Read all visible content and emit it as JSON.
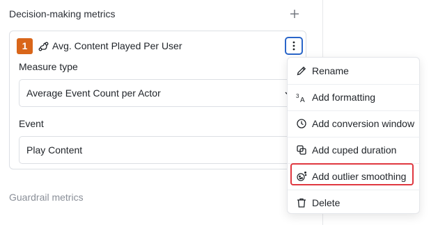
{
  "section": {
    "title": "Decision-making metrics",
    "add_icon": "plus-icon"
  },
  "metric": {
    "index": "1",
    "name": "Avg. Content Played Per User",
    "badge_color": "#d9661a"
  },
  "fields": {
    "measure_type_label": "Measure type",
    "measure_type_value": "Average Event Count per Actor",
    "event_label": "Event",
    "event_value": "Play Content"
  },
  "guardrail": {
    "title": "Guardrail metrics"
  },
  "menu": {
    "items": [
      {
        "label": "Rename",
        "icon": "pencil-icon"
      },
      {
        "label": "Add formatting",
        "icon": "formatting-icon"
      },
      {
        "label": "Add conversion window",
        "icon": "clock-icon"
      },
      {
        "label": "Add cuped duration",
        "icon": "cuped-icon"
      },
      {
        "label": "Add outlier smoothing",
        "icon": "outlier-icon"
      },
      {
        "label": "Delete",
        "icon": "trash-icon"
      }
    ],
    "highlight_color": "#e0373f"
  }
}
